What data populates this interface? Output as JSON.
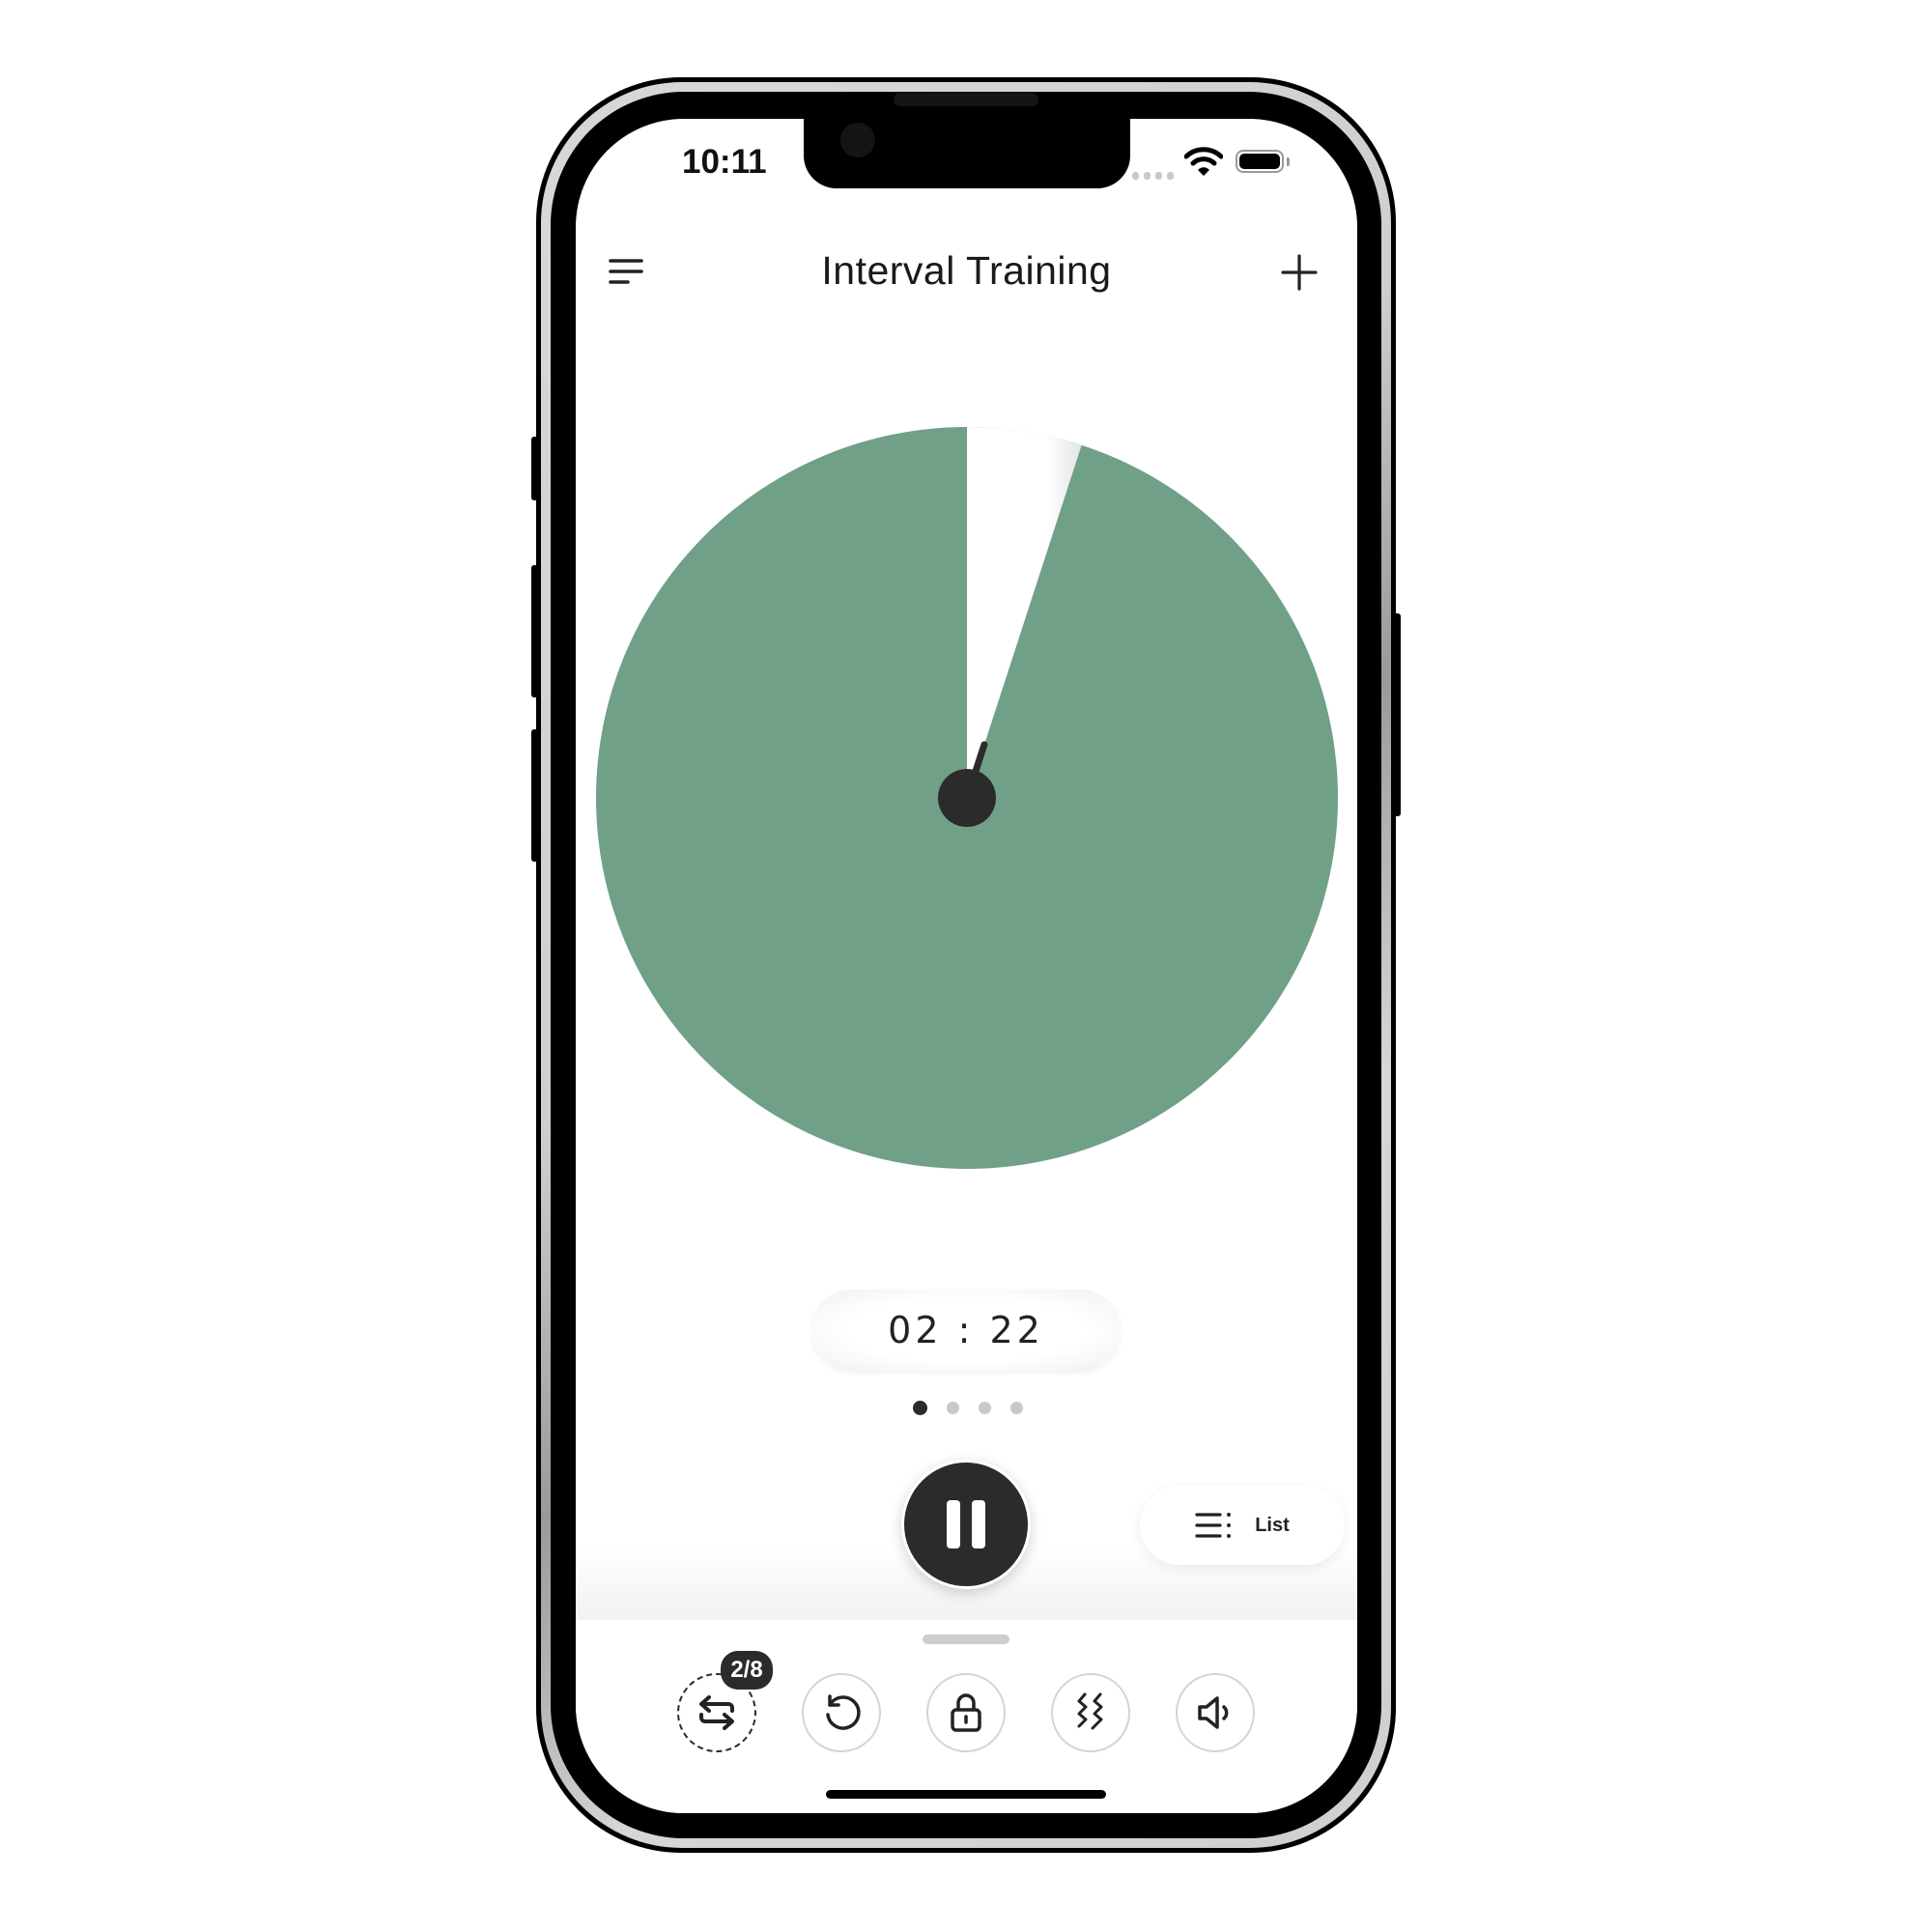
{
  "status_bar": {
    "time": "10:11",
    "signal_icon": "cellular-signal-icon",
    "wifi_icon": "wifi-icon",
    "battery_icon": "battery-icon",
    "battery_level": 1.0
  },
  "header": {
    "title": "Interval Training",
    "menu_icon": "menu-icon",
    "add_icon": "plus-icon"
  },
  "dial": {
    "remaining_color": "#70a088",
    "elapsed_color": "#ffffff",
    "hub_color": "#2b2b2b",
    "elapsed_fraction": 0.05
  },
  "timer": {
    "display": "02 : 22"
  },
  "pager": {
    "count": 4,
    "active_index": 0
  },
  "controls": {
    "pause_icon": "pause-icon",
    "list_label": "List",
    "list_icon": "list-icon"
  },
  "toolbar": {
    "items": [
      {
        "name": "repeat",
        "icon": "repeat-icon",
        "badge": "2/8",
        "active": true
      },
      {
        "name": "reset",
        "icon": "reset-icon"
      },
      {
        "name": "lock",
        "icon": "lock-icon"
      },
      {
        "name": "vibration",
        "icon": "vibration-icon"
      },
      {
        "name": "sound",
        "icon": "volume-icon"
      }
    ]
  }
}
